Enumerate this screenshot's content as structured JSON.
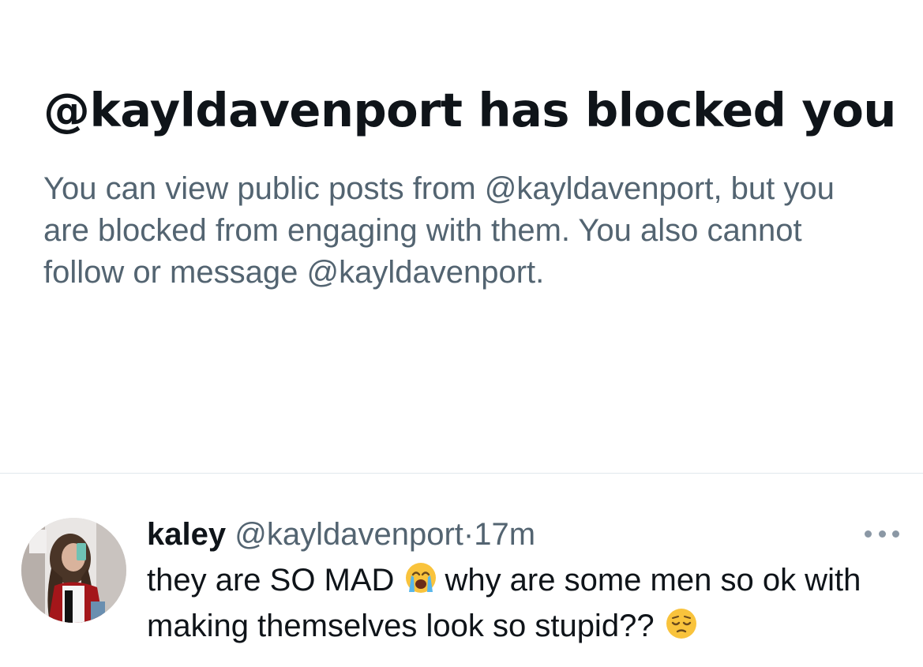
{
  "blocked_notice": {
    "title": "@kayldavenport has blocked you",
    "description": "You can view public posts from @kayldavenport, but you are blocked from engaging with them. You also cannot follow or message @kayldavenport."
  },
  "post": {
    "display_name": "kaley",
    "handle": "@kayldavenport",
    "separator": "·",
    "time": "17m",
    "text_part1": "they are SO MAD",
    "text_part2": "why are some men so ok with making themselves look so stupid??",
    "emoji1": "loudly-crying-face-icon",
    "emoji2": "pensive-face-icon",
    "more_icon": "more-options-icon"
  },
  "colors": {
    "primary_text": "#0f1419",
    "secondary_text": "#536471",
    "divider": "#e1e8ed",
    "background": "#ffffff"
  }
}
